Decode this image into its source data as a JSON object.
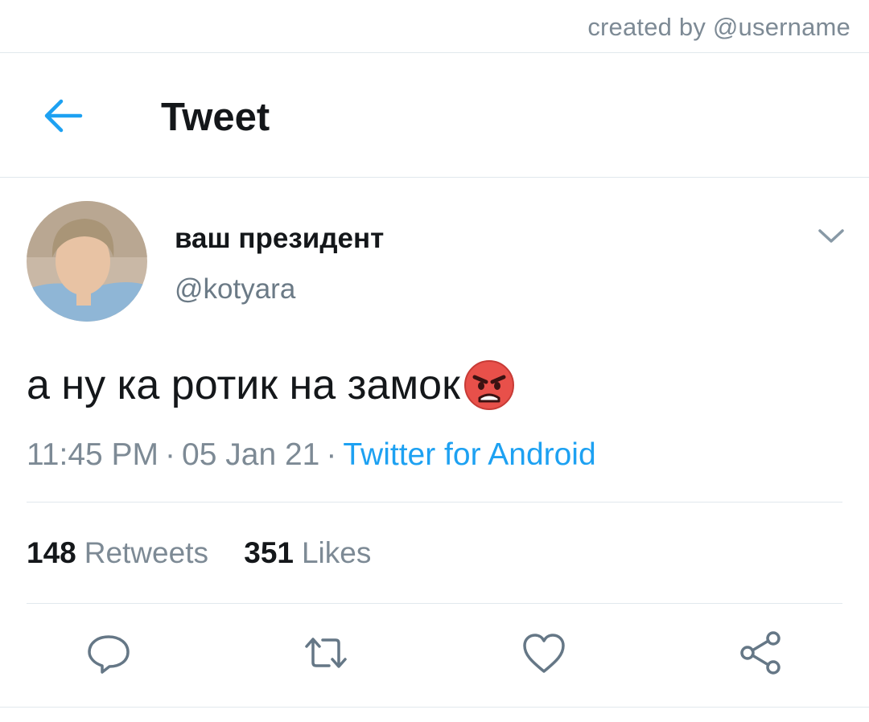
{
  "credit": "created by @username",
  "header": {
    "title": "Tweet",
    "back_icon": "arrow-left-icon"
  },
  "tweet": {
    "display_name": "ваш президент",
    "handle": "@kotyara",
    "text": "а ну ка ротик на замок",
    "emoji": "angry-face-icon",
    "time": "11:45 PM",
    "date": "05 Jan 21",
    "source": "Twitter for Android",
    "separator": "·",
    "retweets_count": "148",
    "retweets_label": "Retweets",
    "likes_count": "351",
    "likes_label": "Likes"
  },
  "actions": [
    "reply-icon",
    "retweet-icon",
    "like-icon",
    "share-icon"
  ],
  "colors": {
    "accent": "#1da1f2",
    "text_primary": "#14171a",
    "text_secondary": "#7d8a95",
    "divider": "#e1e8ed",
    "icon_gray": "#657786"
  }
}
